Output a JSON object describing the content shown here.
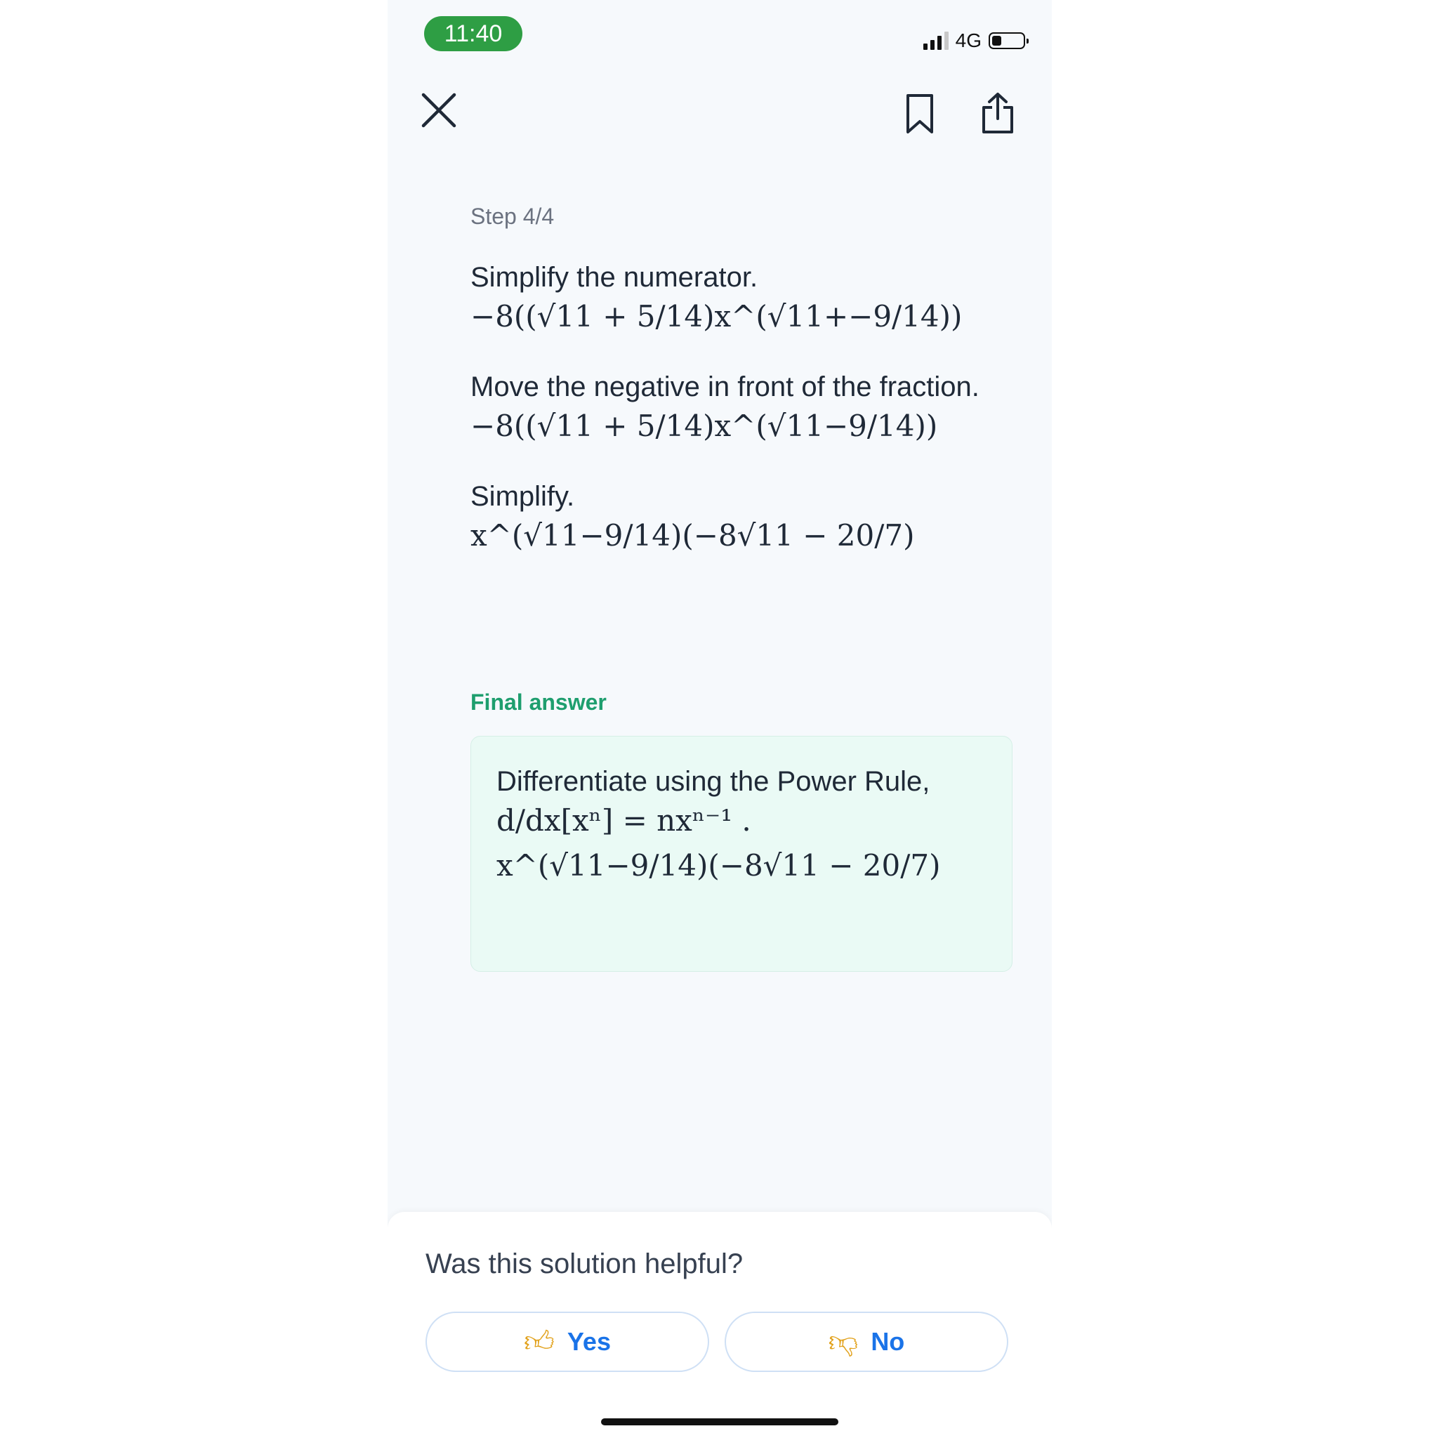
{
  "status_bar": {
    "time": "11:40",
    "network": "4G",
    "battery_level": 0.3,
    "signal_bars": 3,
    "signal_total": 4
  },
  "toolbar": {
    "close_icon": "close-icon",
    "bookmark_icon": "bookmark-icon",
    "share_icon": "share-icon"
  },
  "step": {
    "label": "Step 4/4",
    "blocks": [
      {
        "title": "Simplify the numerator.",
        "math": "−8((√11 + 5/14)x^(√11+−9/14))"
      },
      {
        "title": "Move the negative in front of the fraction.",
        "math": "−8((√11 + 5/14)x^(√11−9/14))"
      },
      {
        "title": "Simplify.",
        "math": "x^(√11−9/14)(−8√11 − 20/7)"
      }
    ]
  },
  "final_answer": {
    "label": "Final answer",
    "title": "Differentiate using the Power Rule,",
    "rule": "d/dx[xⁿ] = nxⁿ⁻¹ .",
    "math": "x^(√11−9/14)(−8√11 − 20/7)"
  },
  "feedback": {
    "question": "Was this solution helpful?",
    "yes_label": "Yes",
    "no_label": "No",
    "yes_icon": "thumbs-up-icon",
    "no_icon": "thumbs-down-icon"
  },
  "colors": {
    "accent": "#1a73e8",
    "final_green": "#1e9e6e",
    "time_pill": "#2e9e44",
    "final_bg": "#eafaf5"
  }
}
